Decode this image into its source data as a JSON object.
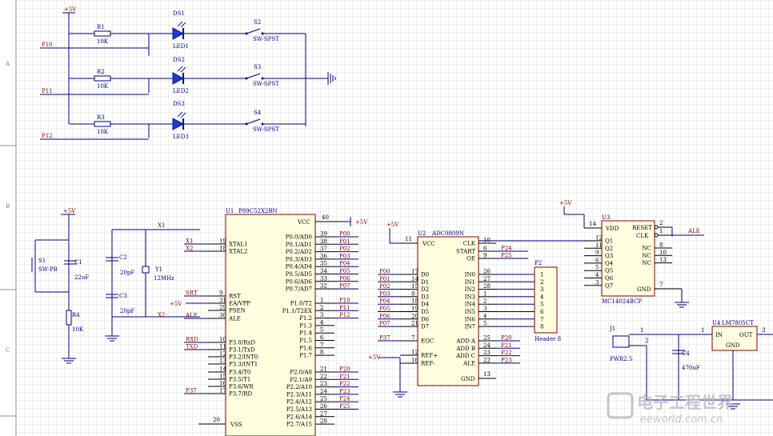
{
  "zones": [
    "A",
    "B",
    "C"
  ],
  "power_labels": {
    "p5v_top": "+5V",
    "p5v_reset": "+5V",
    "p5v_u2": "+5V",
    "p5v_u3": "+5V",
    "p5v_u1_ea": "+5V",
    "p5v_u1_vcc": "+5V",
    "p5v_ref": "+5V"
  },
  "led_section": {
    "rows": [
      {
        "net": "P10",
        "res": "R1",
        "res_val": "10K",
        "ds": "DS1",
        "led": "LED1",
        "sw": "S2",
        "sw_type": "SW-SPST"
      },
      {
        "net": "P11",
        "res": "R2",
        "res_val": "10K",
        "ds": "DS2",
        "led": "LED2",
        "sw": "S3",
        "sw_type": "SW-SPST"
      },
      {
        "net": "P12",
        "res": "R3",
        "res_val": "10K",
        "ds": "DS3",
        "led": "LED3",
        "sw": "S4",
        "sw_type": "SW-SPST"
      }
    ]
  },
  "reset": {
    "sw": "S1",
    "sw_type": "SW-PB",
    "cap": "C1",
    "cap_val": "22uF",
    "res": "R4",
    "res_val": "10K"
  },
  "crystal": {
    "c2": "C2",
    "c2_val": "20pF",
    "c3": "C3",
    "c3_val": "20pF",
    "y": "Y1",
    "y_val": "12MHz",
    "x1": "X1",
    "x2": "X2"
  },
  "u1": {
    "ref": "U1",
    "part": "P89C52X2BN",
    "vcc": "VCC",
    "vcc_pin": "40",
    "vss": "VSS",
    "vss_pin": "20",
    "left_pins": [
      {
        "num": "19",
        "name": "XTAL1",
        "net": "X1"
      },
      {
        "num": "18",
        "name": "XTAL2",
        "net": "X2"
      },
      {
        "num": "9",
        "name": "RST",
        "net": "SRT"
      },
      {
        "num": "31",
        "name": "EA/VPP",
        "net": ""
      },
      {
        "num": "29",
        "name": "PSEN",
        "net": ""
      },
      {
        "num": "30",
        "name": "ALE",
        "net": "ALE"
      },
      {
        "num": "10",
        "name": "P3.0/RxD",
        "net": "RXD"
      },
      {
        "num": "11",
        "name": "P3.1/TxD",
        "net": "TXD"
      },
      {
        "num": "12",
        "name": "P3.2/INT0",
        "net": ""
      },
      {
        "num": "13",
        "name": "P3.3/INT1",
        "net": ""
      },
      {
        "num": "14",
        "name": "P3.4/T0",
        "net": ""
      },
      {
        "num": "15",
        "name": "P3.5/T1",
        "net": ""
      },
      {
        "num": "16",
        "name": "P3.6/WR",
        "net": ""
      },
      {
        "num": "17",
        "name": "P3.7/RD",
        "net": "P37"
      }
    ],
    "p0": [
      {
        "num": "39",
        "name": "P0.0/AD0",
        "net": "P00"
      },
      {
        "num": "38",
        "name": "P0.1/AD1",
        "net": "P01"
      },
      {
        "num": "37",
        "name": "P0.2/AD2",
        "net": "P02"
      },
      {
        "num": "36",
        "name": "P0.3/AD3",
        "net": "P03"
      },
      {
        "num": "35",
        "name": "P0.4/AD4",
        "net": "P04"
      },
      {
        "num": "34",
        "name": "P0.5/AD5",
        "net": "P05"
      },
      {
        "num": "33",
        "name": "P0.6/AD6",
        "net": "P06"
      },
      {
        "num": "32",
        "name": "P0.7/AD7",
        "net": "P07"
      }
    ],
    "p1": [
      {
        "num": "1",
        "name": "P1.0/T2",
        "net": "P10"
      },
      {
        "num": "2",
        "name": "P1.1/T2EX",
        "net": "P11"
      },
      {
        "num": "3",
        "name": "P1.2",
        "net": "P12"
      },
      {
        "num": "4",
        "name": "P1.3",
        "net": ""
      },
      {
        "num": "5",
        "name": "P1.4",
        "net": ""
      },
      {
        "num": "6",
        "name": "P1.5",
        "net": ""
      },
      {
        "num": "7",
        "name": "P1.6",
        "net": ""
      },
      {
        "num": "8",
        "name": "P1.7",
        "net": ""
      }
    ],
    "p2": [
      {
        "num": "21",
        "name": "P2.0/A8",
        "net": "P20"
      },
      {
        "num": "22",
        "name": "P2.1/A9",
        "net": "P21"
      },
      {
        "num": "23",
        "name": "P2.2/A10",
        "net": "P22"
      },
      {
        "num": "24",
        "name": "P2.3/A11",
        "net": "P23"
      },
      {
        "num": "25",
        "name": "P2.4/A12",
        "net": "P24"
      },
      {
        "num": "26",
        "name": "P2.5/A13",
        "net": "P25"
      },
      {
        "num": "27",
        "name": "P2.6/A14",
        "net": ""
      },
      {
        "num": "28",
        "name": "P2.7/A15",
        "net": ""
      }
    ]
  },
  "u2": {
    "ref": "U2",
    "part": "ADC0809N",
    "vcc": "VCC",
    "vcc_pin": "11",
    "data": [
      {
        "num": "17",
        "name": "D0",
        "net": "P00"
      },
      {
        "num": "14",
        "name": "D1",
        "net": "P01"
      },
      {
        "num": "15",
        "name": "D2",
        "net": "P02"
      },
      {
        "num": "8",
        "name": "D3",
        "net": "P03"
      },
      {
        "num": "18",
        "name": "D4",
        "net": "P04"
      },
      {
        "num": "19",
        "name": "D5",
        "net": "P05"
      },
      {
        "num": "20",
        "name": "D6",
        "net": "P06"
      },
      {
        "num": "21",
        "name": "D7",
        "net": "P07"
      }
    ],
    "left_misc": [
      {
        "num": "7",
        "name": "EOC",
        "net": "P37"
      },
      {
        "num": "12",
        "name": "REF+",
        "net": ""
      },
      {
        "num": "16",
        "name": "REF-",
        "net": ""
      }
    ],
    "right_top": [
      {
        "num": "10",
        "name": "CLK",
        "net": ""
      },
      {
        "num": "6",
        "name": "START",
        "net": "P24"
      },
      {
        "num": "9",
        "name": "OE",
        "net": "P25"
      }
    ],
    "inputs": [
      {
        "num": "26",
        "name": "IN0"
      },
      {
        "num": "27",
        "name": "IN1"
      },
      {
        "num": "28",
        "name": "IN2"
      },
      {
        "num": "1",
        "name": "IN3"
      },
      {
        "num": "2",
        "name": "IN4"
      },
      {
        "num": "3",
        "name": "IN5"
      },
      {
        "num": "4",
        "name": "IN6"
      },
      {
        "num": "5",
        "name": "IN7"
      }
    ],
    "addr": [
      {
        "num": "25",
        "name": "ADD A",
        "net": "P20"
      },
      {
        "num": "24",
        "name": "ADD B",
        "net": "P21"
      },
      {
        "num": "23",
        "name": "ADD C",
        "net": "P22"
      },
      {
        "num": "22",
        "name": "ALE",
        "net": "P23"
      }
    ],
    "gnd": "GND",
    "gnd_pin": "13"
  },
  "p2": {
    "ref": "P2",
    "part": "Header 8",
    "pins": [
      "1",
      "2",
      "3",
      "4",
      "5",
      "6",
      "7",
      "8"
    ]
  },
  "u3": {
    "ref": "U3",
    "part": "MC14024BCP",
    "vdd": "VDD",
    "vdd_pin": "14",
    "reset": "RESET",
    "reset_pin": "2",
    "clk": "CLK",
    "clk_pin": "1",
    "clk_net": "ALE",
    "q": [
      {
        "num": "12",
        "name": "Q1"
      },
      {
        "num": "11",
        "name": "Q2"
      },
      {
        "num": "9",
        "name": "Q3"
      },
      {
        "num": "6",
        "name": "Q4"
      },
      {
        "num": "5",
        "name": "Q5"
      },
      {
        "num": "4",
        "name": "Q6"
      },
      {
        "num": "3",
        "name": "Q7"
      }
    ],
    "nc": [
      {
        "num": "8",
        "name": "NC"
      },
      {
        "num": "10",
        "name": "NC"
      },
      {
        "num": "13",
        "name": "NC"
      }
    ],
    "gnd": "GND",
    "gnd_pin": "7"
  },
  "power": {
    "j1": "J1",
    "j1_part": "PWR2.5",
    "c4": "C4",
    "c4_val": "470uF",
    "u4": "U4",
    "u4_part": "LM7805CT",
    "u4_in": "IN",
    "u4_out": "OUT",
    "u4_gnd": "GND",
    "u4_in_pin": "1",
    "u4_out_pin": "3",
    "j1_pin1": "1",
    "j1_pin2": "2"
  },
  "watermark": {
    "line1": "电子工程世界",
    "line2": "eeworld.com.cn"
  }
}
